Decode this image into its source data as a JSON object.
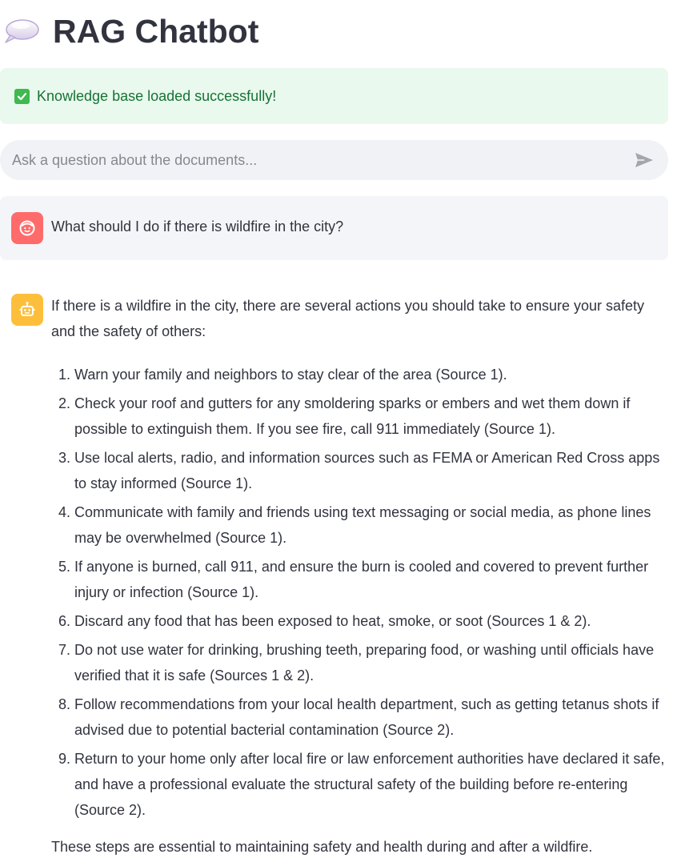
{
  "header": {
    "title": "RAG Chatbot",
    "icon": "speech-balloon-icon"
  },
  "status": {
    "text": "Knowledge base loaded successfully!",
    "icon": "check-mark-icon",
    "colors": {
      "background": "#e9f9ee",
      "text": "#177233",
      "check": "#3fb950"
    }
  },
  "chat_input": {
    "placeholder": "Ask a question about the documents...",
    "value": "",
    "send_icon": "send-icon"
  },
  "messages": [
    {
      "role": "user",
      "avatar_icon": "user-face-icon",
      "avatar_color": "#ff6b6b",
      "text": "What should I do if there is wildfire in the city?"
    },
    {
      "role": "assistant",
      "avatar_icon": "robot-icon",
      "avatar_color": "#fdbf3b",
      "intro": "If there is a wildfire in the city, there are several actions you should take to ensure your safety and the safety of others:",
      "items": [
        "Warn your family and neighbors to stay clear of the area (Source 1).",
        "Check your roof and gutters for any smoldering sparks or embers and wet them down if possible to extinguish them. If you see fire, call 911 immediately (Source 1).",
        "Use local alerts, radio, and information sources such as FEMA or American Red Cross apps to stay informed (Source 1).",
        "Communicate with family and friends using text messaging or social media, as phone lines may be overwhelmed (Source 1).",
        "If anyone is burned, call 911, and ensure the burn is cooled and covered to prevent further injury or infection (Source 1).",
        "Discard any food that has been exposed to heat, smoke, or soot (Sources 1 & 2).",
        "Do not use water for drinking, brushing teeth, preparing food, or washing until officials have verified that it is safe (Sources 1 & 2).",
        "Follow recommendations from your local health department, such as getting tetanus shots if advised due to potential bacterial contamination (Source 2).",
        "Return to your home only after local fire or law enforcement authorities have declared it safe, and have a professional evaluate the structural safety of the building before re-entering (Source 2)."
      ],
      "closing": "These steps are essential to maintaining safety and health during and after a wildfire."
    }
  ]
}
